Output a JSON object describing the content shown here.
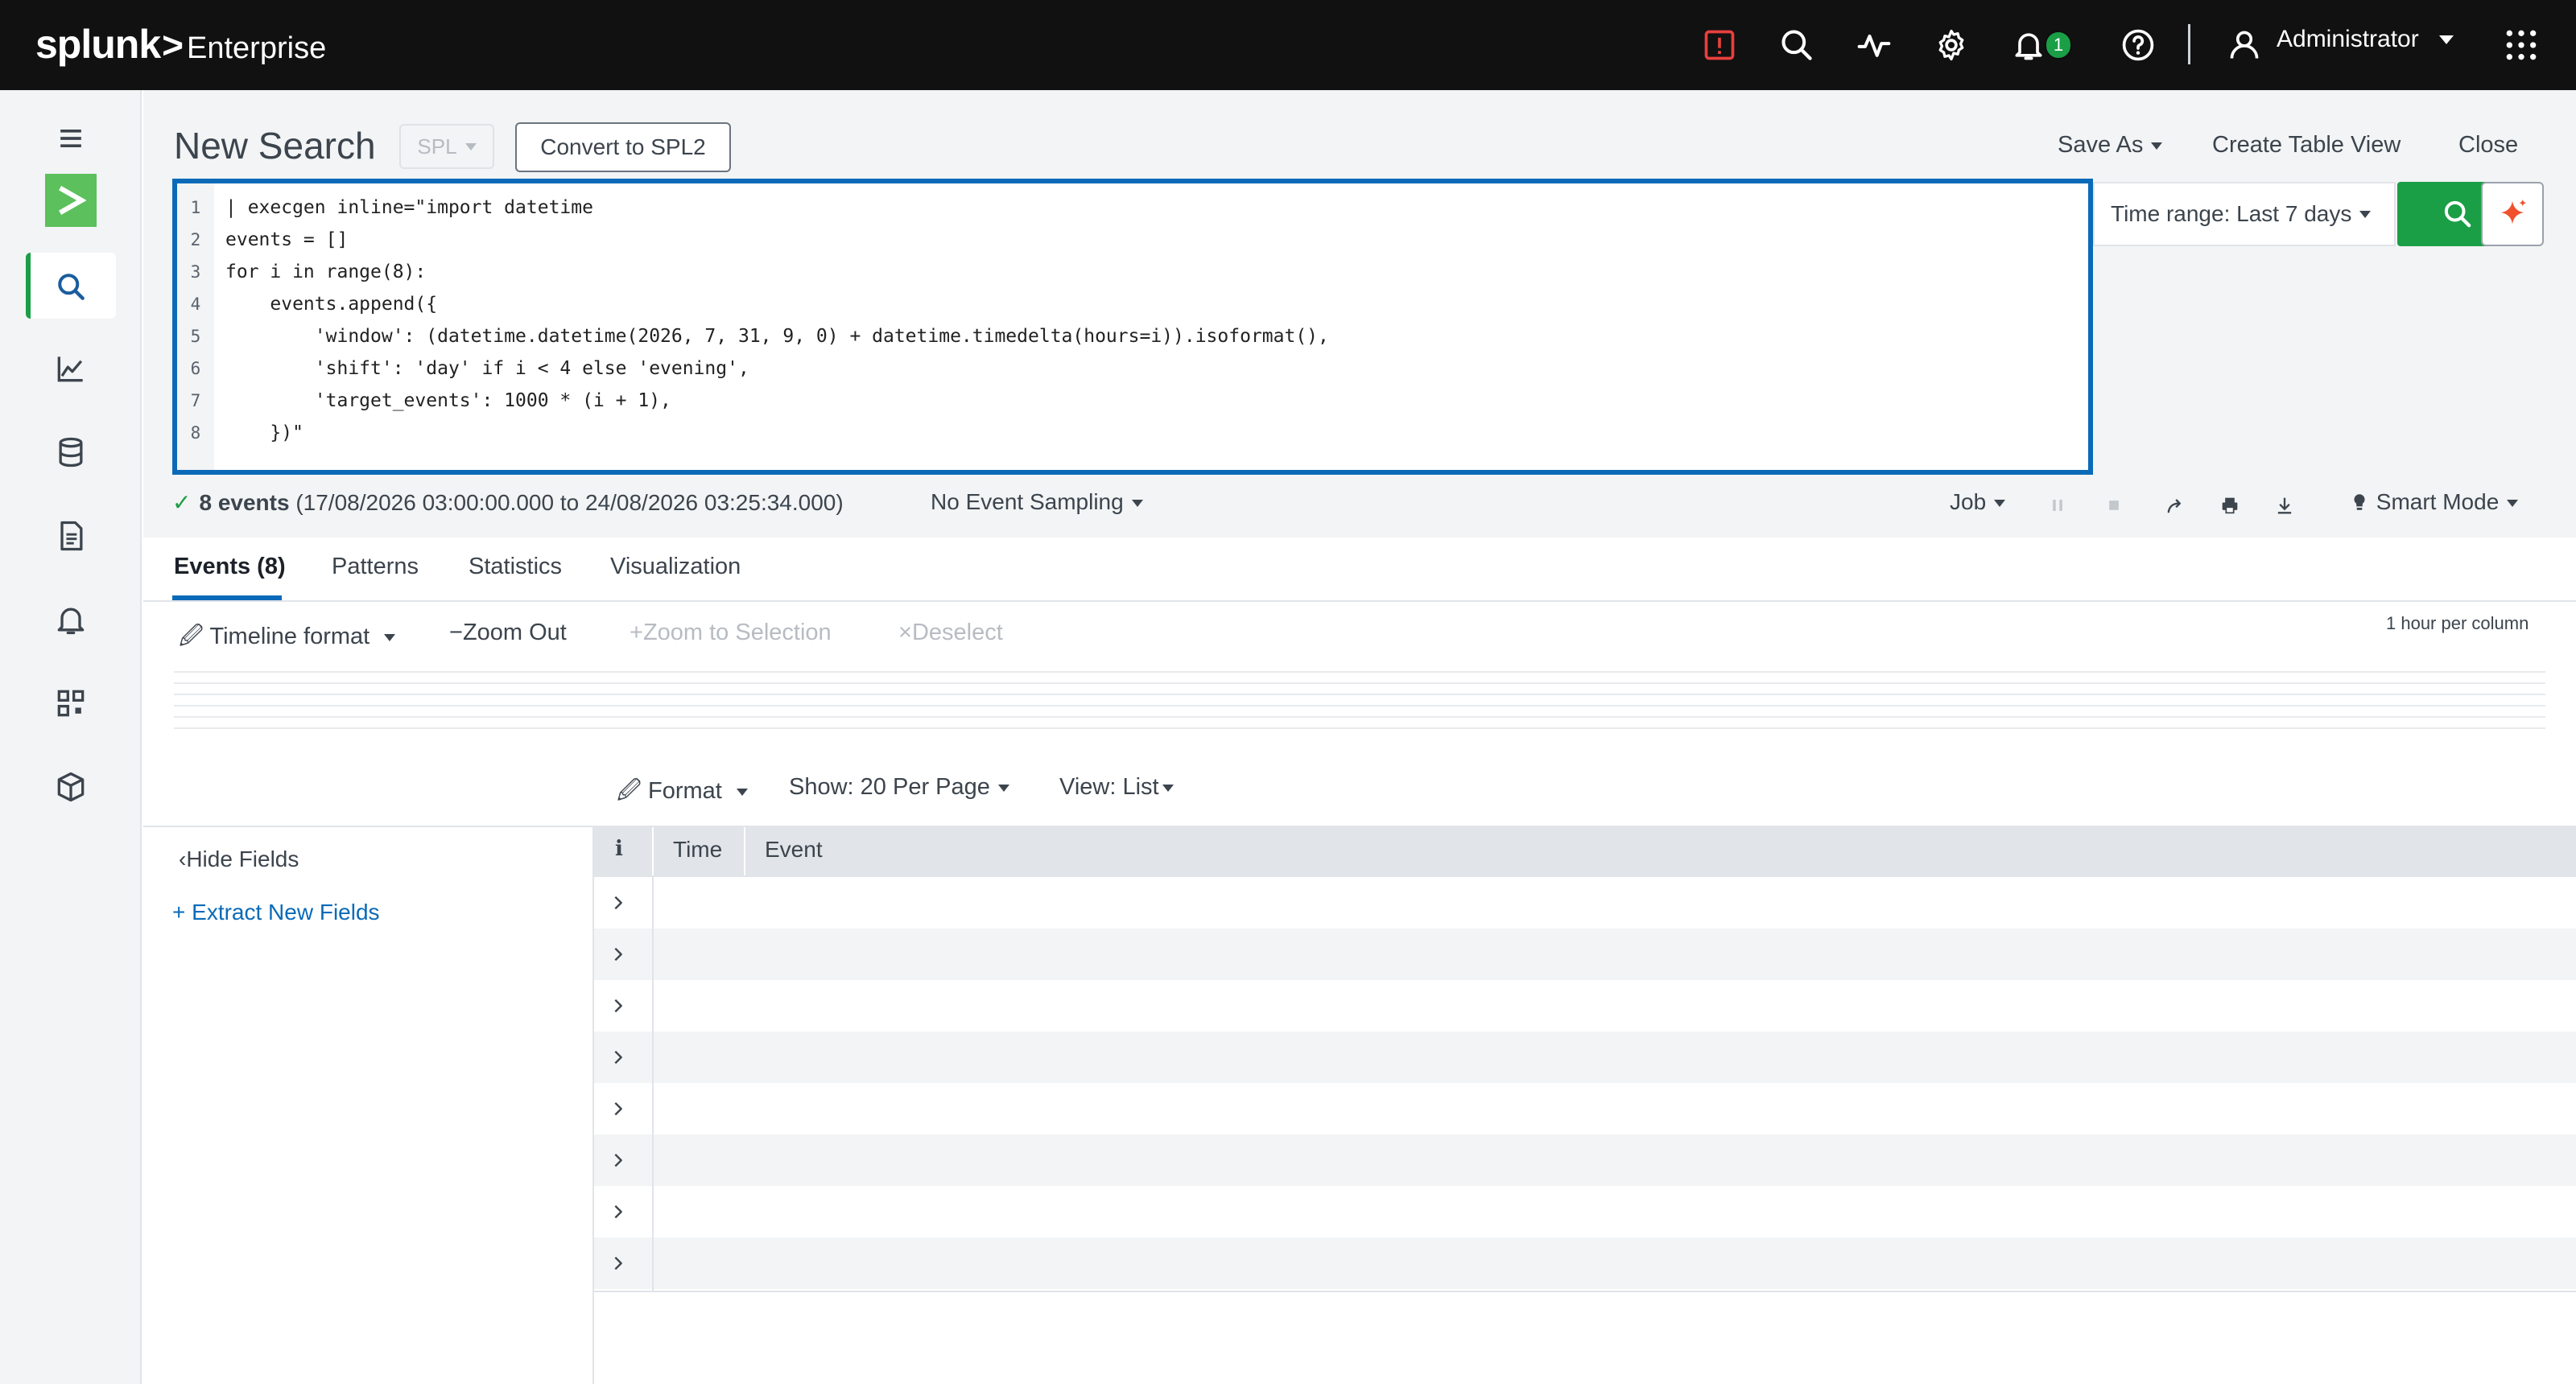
{
  "header": {
    "brand_name": "splunk",
    "brand_gt": ">",
    "brand_product": "Enterprise",
    "notification_count": "1",
    "user_name": "Administrator"
  },
  "search": {
    "title": "New Search",
    "language": "SPL",
    "convert_label": "Convert to SPL2",
    "save_as": "Save As",
    "create_table": "Create Table View",
    "close": "Close",
    "time_range": "Time range: Last 7 days",
    "query_lines": [
      {
        "n": "1",
        "text": "| execgen inline=\"import datetime"
      },
      {
        "n": "2",
        "text": "events = []"
      },
      {
        "n": "3",
        "text": "for i in range(8):"
      },
      {
        "n": "4",
        "text": "    events.append({"
      },
      {
        "n": "5",
        "text": "        'window': (datetime.datetime(2026, 7, 31, 9, 0) + datetime.timedelta(hours=i)).isoformat(),"
      },
      {
        "n": "6",
        "text": "        'shift': 'day' if i < 4 else 'evening',"
      },
      {
        "n": "7",
        "text": "        'target_events': 1000 * (i + 1),"
      },
      {
        "n": "8",
        "text": "    })\""
      }
    ]
  },
  "status": {
    "check": "✓",
    "events_count": "8 events",
    "range": "(17/08/2026 03:00:00.000 to 24/08/2026 03:25:34.000)",
    "sampling": "No Event Sampling",
    "job": "Job",
    "mode": "Smart Mode"
  },
  "tabs": [
    {
      "label": "Events (8)"
    },
    {
      "label": "Patterns"
    },
    {
      "label": "Statistics"
    },
    {
      "label": "Visualization"
    }
  ],
  "timeline": {
    "format": "Timeline format",
    "zoom_out": "Zoom Out",
    "zoom_selection": "Zoom to Selection",
    "deselect": "Deselect",
    "hint": "1 hour per column"
  },
  "results": {
    "format": "Format",
    "show": "Show: 20 Per Page",
    "view": "View: List",
    "hide_fields": "Hide Fields",
    "extract_fields": "Extract New Fields",
    "col_info": "i",
    "col_time": "Time",
    "col_event": "Event"
  },
  "colors": {
    "accent_green": "#1a9e46",
    "accent_blue": "#0a6ab8",
    "alert_red": "#e8403e"
  }
}
